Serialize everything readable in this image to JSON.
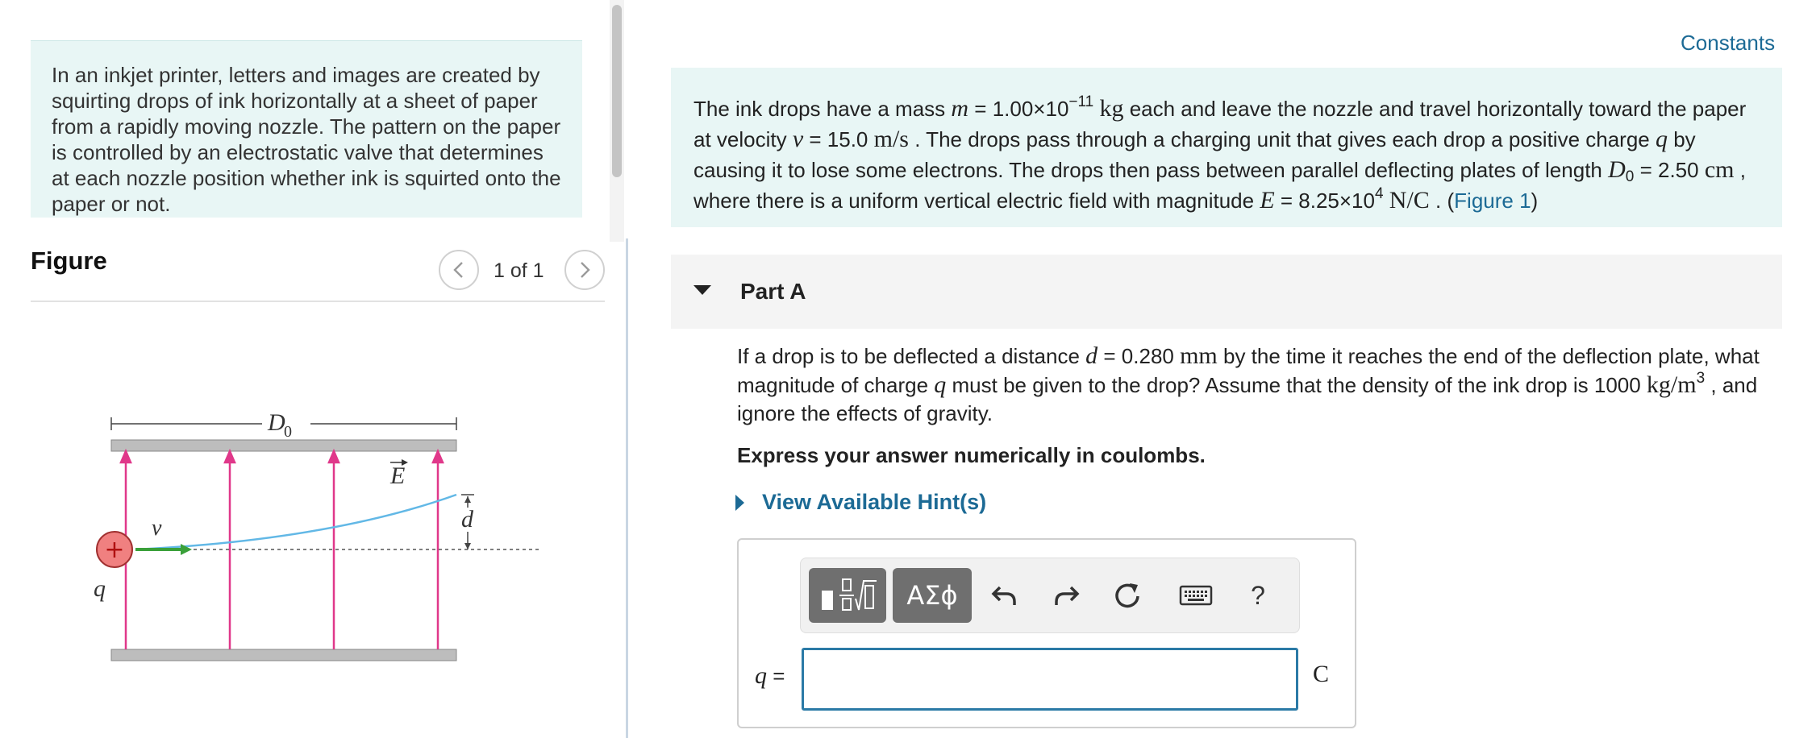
{
  "intro": {
    "text": "In an inkjet printer, letters and images are created by squirting drops of ink horizontally at a sheet of paper from a rapidly moving nozzle. The pattern on the paper is controlled by an electrostatic valve that determines at each nozzle position whether ink is squirted onto the paper or not."
  },
  "figure_panel": {
    "title": "Figure",
    "counter": "1 of 1",
    "prev_icon": "chevron-left-icon",
    "next_icon": "chevron-right-icon",
    "labels": {
      "length": "D",
      "length_sub": "0",
      "field": "E",
      "velocity": "v",
      "charge": "q",
      "deflection": "d",
      "plus": "+"
    },
    "colors": {
      "field_arrows": "#e0388a",
      "trajectory": "#62b8e6",
      "velocity_arrow": "#3aa03a",
      "drop_fill": "#f08080",
      "plate": "#bdbdbd"
    }
  },
  "constants_link": "Constants",
  "problem": {
    "t1": "The ink drops have a mass ",
    "m_sym": "m",
    "t2": " = 1.00×10",
    "m_exp": "−11",
    "m_unit": "kg",
    "t3": " each and leave the nozzle and travel horizontally toward the paper at velocity ",
    "v_sym": "v",
    "t4": " = 15.0 ",
    "v_unit": "m/s",
    "t5": " . The drops pass through a charging unit that gives each drop a positive charge ",
    "q_sym": "q",
    "t6": " by causing it to lose some electrons. The drops then pass between parallel deflecting plates of length ",
    "d0_sym": "D",
    "d0_sub": "0",
    "t7": " = 2.50 ",
    "d0_unit": "cm",
    "t8": " , where there is a uniform vertical electric field with magnitude ",
    "e_sym": "E",
    "t9": " = 8.25×10",
    "e_exp": "4",
    "e_unit": "N/C",
    "t10": " . (",
    "figure_link": "Figure 1",
    "t11": ")"
  },
  "part": {
    "title": "Part A",
    "question": {
      "q1": "If a drop is to be deflected a distance ",
      "d_sym": "d",
      "q2": " = 0.280 ",
      "d_unit": "mm",
      "q3": " by the time it reaches the end of the deflection plate, what magnitude of charge ",
      "q_sym": "q",
      "q4": " must be given to the drop? Assume that the density of the ink drop is 1000 ",
      "rho_unit": "kg/m",
      "rho_exp": "3",
      "q5": " , and ignore the effects of gravity."
    },
    "instruction": "Express your answer numerically in coulombs.",
    "hint_label": "View Available Hint(s)"
  },
  "answer": {
    "label_sym": "q",
    "label_eq": " =",
    "value": "",
    "unit": "C",
    "toolbar": {
      "templates_icon": "fraction-sqrt-template-icon",
      "greek_label": "ΑΣϕ",
      "undo_icon": "undo-icon",
      "redo_icon": "redo-icon",
      "reset_icon": "reset-icon",
      "keyboard_icon": "keyboard-icon",
      "help_label": "?"
    }
  }
}
